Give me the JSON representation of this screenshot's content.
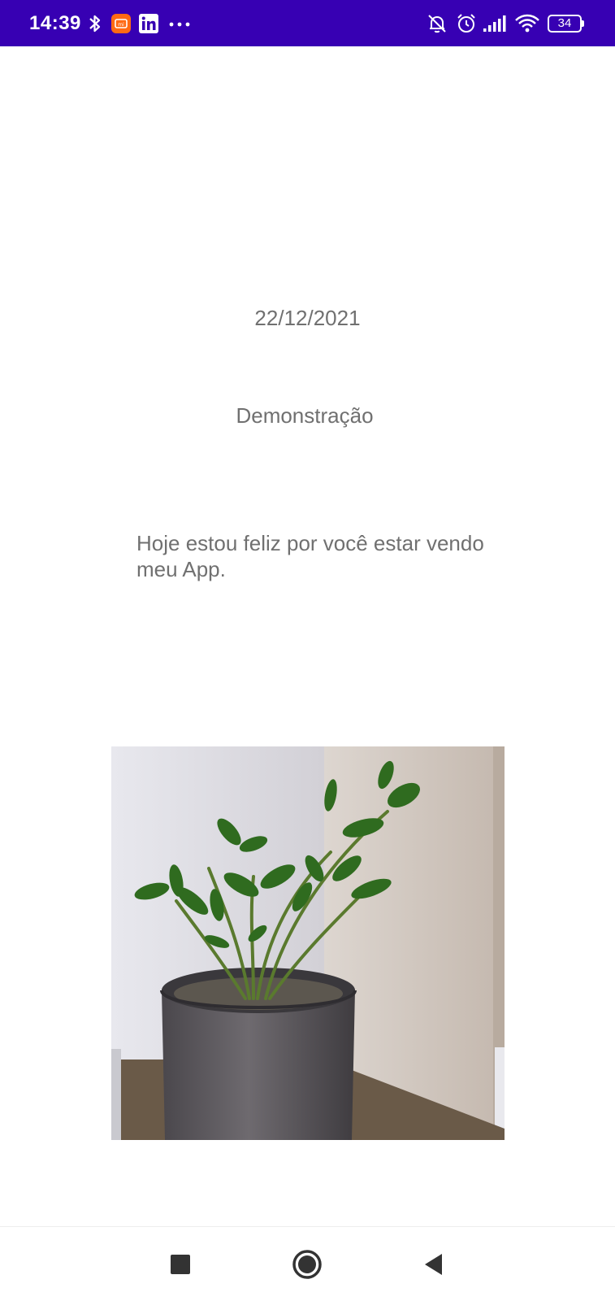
{
  "status_bar": {
    "time": "14:39",
    "battery_level": "34",
    "background_color": "#3700b3",
    "left_icons": [
      "bluetooth-icon",
      "mi-app-icon",
      "linkedin-icon",
      "more-notifications-icon"
    ],
    "right_icons": [
      "notifications-off-icon",
      "alarm-icon",
      "signal-icon",
      "wifi-icon",
      "battery-icon"
    ]
  },
  "main": {
    "date": "22/12/2021",
    "title": "Demonstração",
    "message": "Hoje estou feliz por você estar vendo meu App.",
    "text_color": "#707070"
  },
  "nav_bar": {
    "buttons": [
      "recents-button",
      "home-button",
      "back-button"
    ]
  }
}
